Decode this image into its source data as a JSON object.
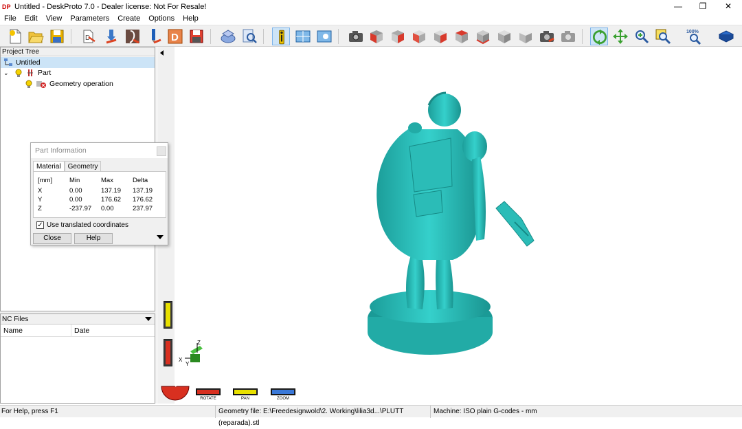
{
  "window": {
    "title": "Untitled - DeskProto 7.0 - Dealer license: Not For Resale!",
    "icon_text": "DP",
    "controls": {
      "minimize": "—",
      "maximize": "❐",
      "close": "✕"
    }
  },
  "menu": [
    "File",
    "Edit",
    "View",
    "Parameters",
    "Create",
    "Options",
    "Help"
  ],
  "toolbar": {
    "zoom_percent_label": "100%",
    "buttons": [
      "new-project",
      "open-project",
      "save-project",
      "import-geometry",
      "part-parameters",
      "operation-parameters",
      "tool-icon",
      "delete-icon",
      "save-nc",
      "simulation",
      "simulation-view",
      "info",
      "split-view",
      "bitmap-view",
      "screenshot",
      "view-front",
      "view-back",
      "view-left",
      "view-right",
      "view-top",
      "view-bottom",
      "view-iso",
      "view-iso2",
      "camera-set",
      "camera-get",
      "rotate-mode",
      "pan-mode",
      "zoom-in",
      "zoom-window",
      "zoom-100",
      "help-book"
    ]
  },
  "project_tree": {
    "header": "Project Tree",
    "items": [
      {
        "label": "Untitled",
        "level": 0
      },
      {
        "label": "Part",
        "level": 1
      },
      {
        "label": "Geometry operation",
        "level": 2
      }
    ]
  },
  "nc_files": {
    "header": "NC Files",
    "columns": [
      "Name",
      "Date"
    ]
  },
  "part_info_dialog": {
    "title": "Part Information",
    "tabs": [
      "Material",
      "Geometry"
    ],
    "headers": [
      "[mm]",
      "Min",
      "Max",
      "Delta"
    ],
    "rows": [
      [
        "X",
        "0.00",
        "137.19",
        "137.19"
      ],
      [
        "Y",
        "0.00",
        "176.62",
        "176.62"
      ],
      [
        "Z",
        "-237.97",
        "0.00",
        "237.97"
      ]
    ],
    "checkbox_label": "Use translated coordinates",
    "checkbox_checked": true,
    "close_label": "Close",
    "help_label": "Help"
  },
  "viewport": {
    "axis_x": "X",
    "axis_y": "Y",
    "axis_z": "Z",
    "nav_labels": [
      "ROTATE",
      "PAN",
      "ZOOM"
    ],
    "model_color": "#2ec4c0"
  },
  "status": {
    "help": "For Help, press F1",
    "geometry_file": "Geometry file: E:\\Freedesignwold\\2. Working\\lilia3d...\\PLUTT (reparada).stl",
    "machine": "Machine: ISO plain G-codes - mm"
  }
}
